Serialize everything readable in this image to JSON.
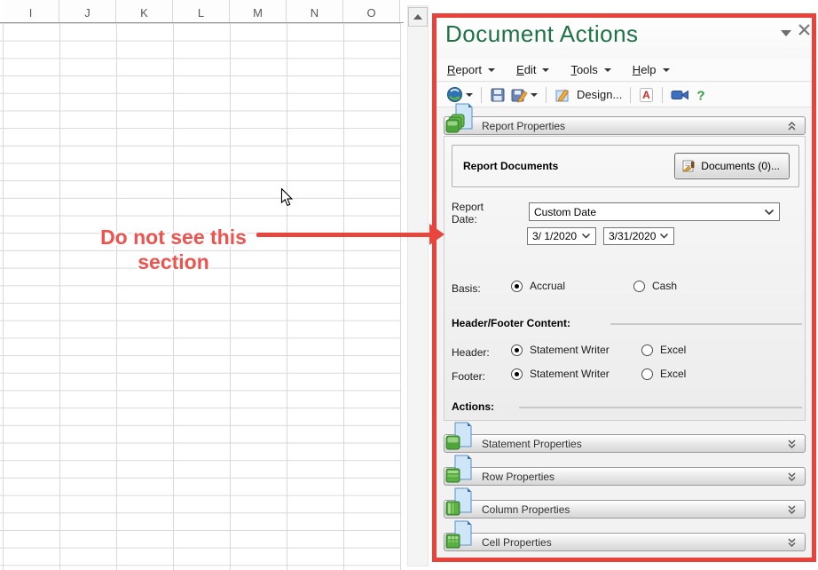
{
  "spreadsheet": {
    "columns": [
      "I",
      "J",
      "K",
      "L",
      "M",
      "N",
      "O"
    ]
  },
  "annotation": {
    "line1": "Do not see this",
    "line2": "section"
  },
  "colors": {
    "accent_red": "#e8423a",
    "title_teal": "#1f7246"
  },
  "panel": {
    "title": "Document Actions",
    "menu": [
      {
        "key": "R",
        "rest": "eport"
      },
      {
        "key": "E",
        "rest": "dit"
      },
      {
        "key": "T",
        "rest": "ools"
      },
      {
        "key": "H",
        "rest": "elp"
      }
    ],
    "toolbar": {
      "design_label": "Design..."
    },
    "report_properties": {
      "title": "Report Properties",
      "report_documents_label": "Report Documents",
      "documents_button": "Documents (0)...",
      "report_date_label": "Report Date:",
      "date_preset": "Custom Date",
      "date_from": "3/ 1/2020",
      "date_to": "3/31/2020",
      "basis_label": "Basis:",
      "basis_options": [
        "Accrual",
        "Cash"
      ],
      "basis_selected": "Accrual",
      "header_footer_label": "Header/Footer Content:",
      "header_label": "Header:",
      "footer_label": "Footer:",
      "hf_options": [
        "Statement Writer",
        "Excel"
      ],
      "header_selected": "Statement Writer",
      "footer_selected": "Statement Writer",
      "actions_label": "Actions:"
    },
    "collapsed_sections": [
      {
        "title": "Statement Properties"
      },
      {
        "title": "Row Properties"
      },
      {
        "title": "Column Properties"
      },
      {
        "title": "Cell Properties"
      }
    ]
  }
}
